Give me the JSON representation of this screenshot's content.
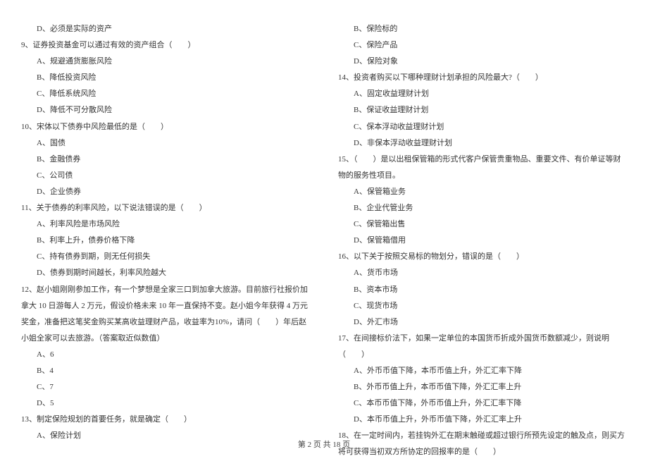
{
  "left": {
    "opt8D": "D、必须是实际的资产",
    "q9": "9、证券投资基金可以通过有效的资产组合（　　）",
    "q9A": "A、规避通货膨胀风险",
    "q9B": "B、降低投资风险",
    "q9C": "C、降低系统风险",
    "q9D": "D、降低不可分散风险",
    "q10": "10、宋体以下债券中风险最低的是（　　）",
    "q10A": "A、国债",
    "q10B": "B、金融债券",
    "q10C": "C、公司债",
    "q10D": "D、企业债券",
    "q11": "11、关于债券的利率风险，以下说法错误的是（　　）",
    "q11A": "A、利率风险是市场风险",
    "q11B": "B、利率上升，债券价格下降",
    "q11C": "C、持有债券到期，则无任何损失",
    "q11D": "D、债券到期时间越长，利率风险越大",
    "q12": "12、赵小姐刚刚参加工作，有一个梦想是全家三口到加拿大旅游。目前旅行社报价加拿大 10 日游每人 2 万元，假设价格未来 10 年一直保持不变。赵小姐今年获得 4 万元奖金，准备把这笔奖金购买某高收益理财产品，收益率为10%，请问（　　）年后赵小姐全家可以去旅游。（答案取近似数值）",
    "q12A": "A、6",
    "q12B": "B、4",
    "q12C": "C、7",
    "q12D": "D、5",
    "q13": "13、制定保险规划的首要任务，就是确定（　　）",
    "q13A": "A、保险计划"
  },
  "right": {
    "q13B": "B、保险标的",
    "q13C": "C、保险产品",
    "q13D": "D、保险对象",
    "q14": "14、投资者购买以下哪种理财计划承担的风险最大?（　　）",
    "q14A": "A、固定收益理财计划",
    "q14B": "B、保证收益理财计划",
    "q14C": "C、保本浮动收益理财计划",
    "q14D": "D、非保本浮动收益理财计划",
    "q15": "15、（　　）是以出租保管箱的形式代客户保管贵重物品、重要文件、有价单证等财物的服务性项目。",
    "q15A": "A、保管箱业务",
    "q15B": "B、企业代管业务",
    "q15C": "C、保管箱出售",
    "q15D": "D、保管箱借用",
    "q16": "16、以下关于按照交易标的物划分，错误的是（　　）",
    "q16A": "A、货币市场",
    "q16B": "B、资本市场",
    "q16C": "C、现货市场",
    "q16D": "D、外汇市场",
    "q17": "17、在间接标价法下，如果一定单位的本国货币折成外国货币数额减少，则说明（　　）",
    "q17A": "A、外币币值下降，本币币值上升，外汇汇率下降",
    "q17B": "B、外币币值上升，本币币值下降，外汇汇率上升",
    "q17C": "C、本币币值下降，外币币值上升，外汇汇率下降",
    "q17D": "D、本币币值上升，外币币值下降，外汇汇率上升",
    "q18": "18、在一定时间内，若挂钩外汇在期末触碰或超过银行所预先设定的触及点，则买方将可获得当初双方所协定的回报率的是（　　）"
  },
  "footer": "第 2 页 共 18 页"
}
